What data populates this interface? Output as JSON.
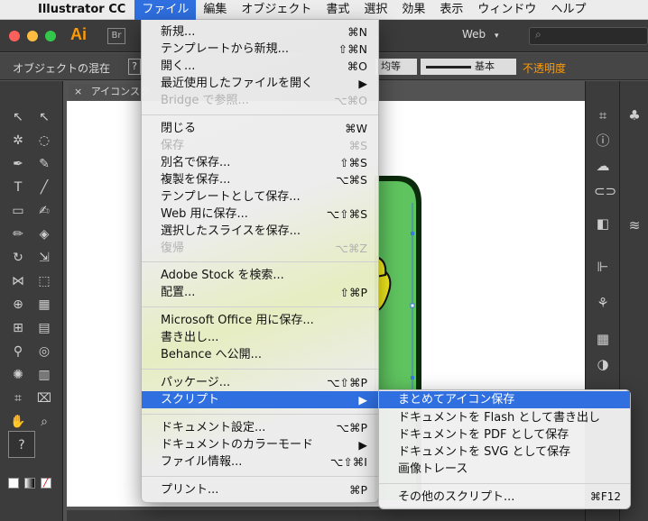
{
  "menubar": {
    "app_name": "Illustrator CC",
    "items": [
      "ファイル",
      "編集",
      "オブジェクト",
      "書式",
      "選択",
      "効果",
      "表示",
      "ウィンドウ",
      "ヘルプ"
    ]
  },
  "appbar": {
    "logo": "Ai",
    "bridge": "Br",
    "workspace": "Web",
    "search_placeholder": "⌕"
  },
  "control_bar": {
    "label": "オブジェクトの混在",
    "q_label": "?",
    "proportion": "均等",
    "stroke_profile": "基本",
    "opacity_label": "不透明度"
  },
  "document": {
    "tab_title": "アイコンスク"
  },
  "file_menu": {
    "items": [
      {
        "label": "新規...",
        "shortcut": "⌘N",
        "enabled": true
      },
      {
        "label": "テンプレートから新規...",
        "shortcut": "⇧⌘N",
        "enabled": true
      },
      {
        "label": "開く...",
        "shortcut": "⌘O",
        "enabled": true
      },
      {
        "label": "最近使用したファイルを開く",
        "shortcut": "▶",
        "enabled": true
      },
      {
        "label": "Bridge で参照...",
        "shortcut": "⌥⌘O",
        "enabled": false
      },
      {
        "label": "閉じる",
        "shortcut": "⌘W",
        "enabled": true
      },
      {
        "label": "保存",
        "shortcut": "⌘S",
        "enabled": false
      },
      {
        "label": "別名で保存...",
        "shortcut": "⇧⌘S",
        "enabled": true
      },
      {
        "label": "複製を保存...",
        "shortcut": "⌥⌘S",
        "enabled": true
      },
      {
        "label": "テンプレートとして保存...",
        "shortcut": "",
        "enabled": true
      },
      {
        "label": "Web 用に保存...",
        "shortcut": "⌥⇧⌘S",
        "enabled": true
      },
      {
        "label": "選択したスライスを保存...",
        "shortcut": "",
        "enabled": true
      },
      {
        "label": "復帰",
        "shortcut": "⌥⌘Z",
        "enabled": false
      },
      {
        "label": "Adobe Stock を検索...",
        "shortcut": "",
        "enabled": true
      },
      {
        "label": "配置...",
        "shortcut": "⇧⌘P",
        "enabled": true
      },
      {
        "label": "Microsoft Office 用に保存...",
        "shortcut": "",
        "enabled": true
      },
      {
        "label": "書き出し...",
        "shortcut": "",
        "enabled": true
      },
      {
        "label": "Behance へ公開...",
        "shortcut": "",
        "enabled": true
      },
      {
        "label": "パッケージ...",
        "shortcut": "⌥⇧⌘P",
        "enabled": true
      },
      {
        "label": "スクリプト",
        "shortcut": "▶",
        "enabled": true
      },
      {
        "label": "ドキュメント設定...",
        "shortcut": "⌥⌘P",
        "enabled": true
      },
      {
        "label": "ドキュメントのカラーモード",
        "shortcut": "▶",
        "enabled": true
      },
      {
        "label": "ファイル情報...",
        "shortcut": "⌥⇧⌘I",
        "enabled": true
      },
      {
        "label": "プリント...",
        "shortcut": "⌘P",
        "enabled": true
      }
    ]
  },
  "script_submenu": {
    "items": [
      {
        "label": "まとめてアイコン保存",
        "shortcut": ""
      },
      {
        "label": "ドキュメントを Flash として書き出し",
        "shortcut": ""
      },
      {
        "label": "ドキュメントを PDF として保存",
        "shortcut": ""
      },
      {
        "label": "ドキュメントを SVG として保存",
        "shortcut": ""
      },
      {
        "label": "画像トレース",
        "shortcut": ""
      },
      {
        "label": "その他のスクリプト...",
        "shortcut": "⌘F12"
      }
    ]
  },
  "colors": {
    "menu_highlight": "#2f6fe0",
    "illustrator_orange": "#ff9a00",
    "art_green": "#5fc45f",
    "art_yellow": "#f4ec1e"
  }
}
